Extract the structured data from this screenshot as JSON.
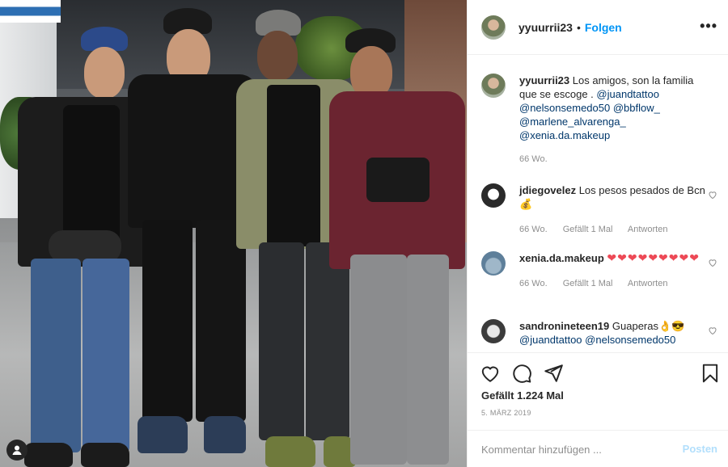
{
  "post": {
    "username": "yyuurrii23",
    "follow_label": "Folgen",
    "more_label": "•••",
    "dot": "•"
  },
  "caption": {
    "username": "yyuurrii23",
    "text": "Los amigos, son la familia que se escoge .",
    "mentions": [
      "@juandtattoo",
      "@nelsonsemedo50",
      "@bbflow_",
      "@marlene_alvarenga_",
      "@xenia.da.makeup"
    ],
    "age": "66 Wo."
  },
  "comments": [
    {
      "username": "jdiegovelez",
      "text": "Los pesos pesados de Bcn 💰",
      "age": "66 Wo.",
      "likes": "Gefällt 1 Mal",
      "reply": "Antworten"
    },
    {
      "username": "xenia.da.makeup",
      "text": "❤❤❤❤❤❤❤❤❤",
      "age": "66 Wo.",
      "likes": "Gefällt 1 Mal",
      "reply": "Antworten"
    },
    {
      "username": "sandronineteen19",
      "text": "Guaperas👌😎",
      "mentions": [
        "@juandtattoo",
        "@nelsonsemedo50"
      ]
    }
  ],
  "actions": {
    "likes": "Gefällt 1.224 Mal",
    "date": "5. März 2019"
  },
  "add_comment": {
    "placeholder": "Kommentar hinzufügen ...",
    "post_label": "Posten"
  },
  "icons": {
    "like": "heart-icon",
    "comment": "comment-icon",
    "share": "send-icon",
    "save": "bookmark-icon",
    "more": "more-icon",
    "tagged": "user-tag-icon"
  },
  "colors": {
    "link": "#00376b",
    "follow": "#0095f6",
    "post_disabled": "#b2dffc",
    "heart": "#ed4956",
    "muted": "#8e8e8e"
  }
}
